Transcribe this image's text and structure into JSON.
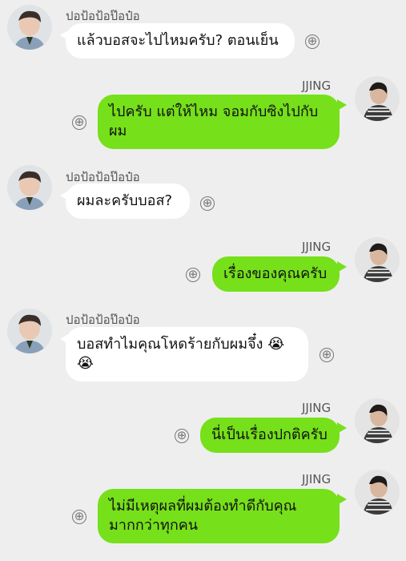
{
  "icons": {
    "add": "⊕"
  },
  "messages": [
    {
      "side": "in",
      "sender": "ปอป้อป้อป๊อป๋อ",
      "text": "แล้วบอสจะไปไหมครับ? ตอนเย็น"
    },
    {
      "side": "out",
      "sender": "JJING",
      "text": "ไปครับ แต่ให้ไหม จอมกับซิงไปกับผม"
    },
    {
      "side": "in",
      "sender": "ปอป้อป้อป๊อป๋อ",
      "text": "ผมละครับบอส?"
    },
    {
      "side": "out",
      "sender": "JJING",
      "text": "เรื่องของคุณครับ"
    },
    {
      "side": "in",
      "sender": "ปอป้อป้อป๊อป๋อ",
      "text": "บอสทำไมคุณโหดร้ายกับผมจึ๋ง 😭😭"
    },
    {
      "side": "out",
      "sender": "JJING",
      "text": "นี่เป็นเรื่องปกติครับ"
    },
    {
      "side": "out",
      "sender": "JJING",
      "text": "ไม่มีเหตุผลที่ผมต้องทำดีกับคุณมากกว่าทุกคน"
    }
  ]
}
